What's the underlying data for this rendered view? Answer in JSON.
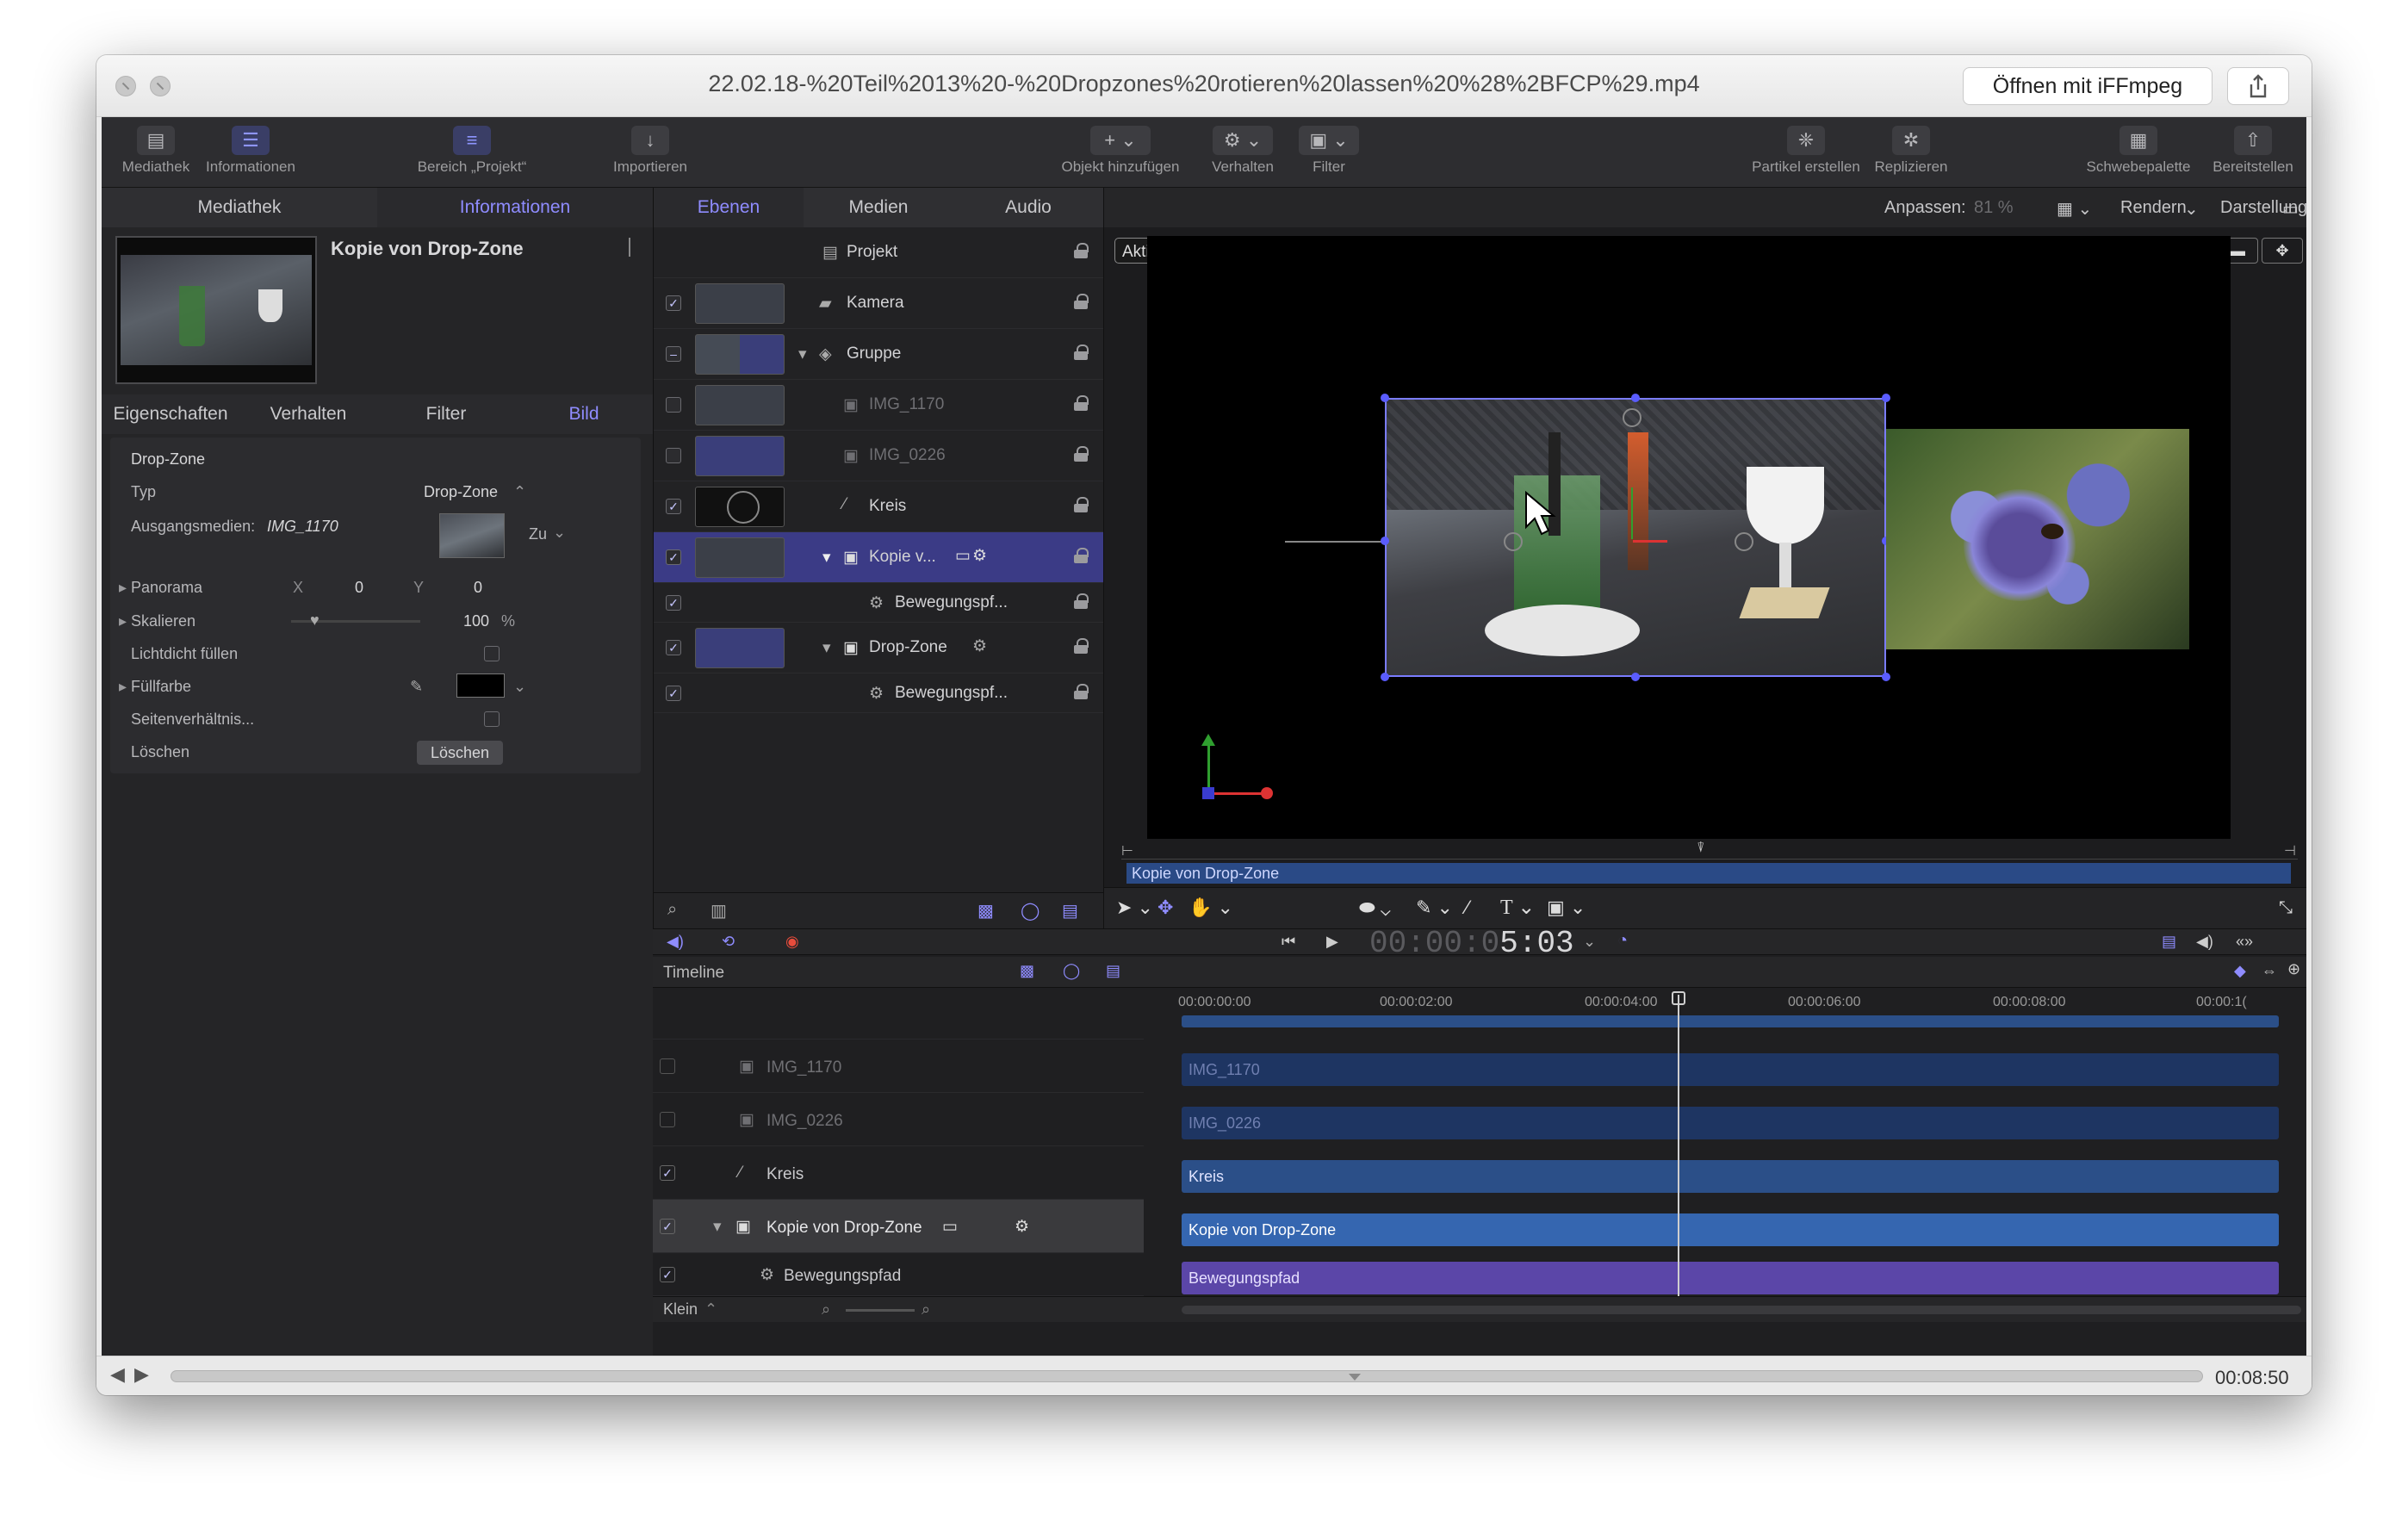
{
  "window": {
    "title": "22.02.18-%20Teil%2013%20-%20Dropzones%20rotieren%20lassen%20%28%2BFCP%29.mp4",
    "open_with_label": "Öffnen mit iFFmpeg",
    "share_icon": "share-icon"
  },
  "toolbar": {
    "library": "Mediathek",
    "inspector": "Informationen",
    "project_pane": "Bereich „Projekt“",
    "import": "Importieren",
    "add_object": "Objekt hinzufügen",
    "behaviors": "Verhalten",
    "filters": "Filter",
    "make_particles": "Partikel erstellen",
    "replicate": "Replizieren",
    "hud": "Schwebepalette",
    "share": "Bereitstellen"
  },
  "left_panel": {
    "tabs": [
      "Mediathek",
      "Informationen"
    ],
    "selected_tab": "Informationen",
    "preview_title": "Kopie von Drop-Zone",
    "sub_tabs": [
      "Eigenschaften",
      "Verhalten",
      "Filter",
      "Bild"
    ],
    "selected_sub_tab": "Bild",
    "section": "Drop-Zone",
    "props": {
      "type_label": "Typ",
      "type_value": "Drop-Zone",
      "source_label": "Ausgangsmedien:",
      "source_value": "IMG_1170",
      "to_label": "Zu",
      "pan_label": "Panorama",
      "pan_x_label": "X",
      "pan_x": "0",
      "pan_y_label": "Y",
      "pan_y": "0",
      "scale_label": "Skalieren",
      "scale_value": "100",
      "scale_unit": "%",
      "fill_opaque_label": "Lichtdicht füllen",
      "fill_color_label": "Füllfarbe",
      "aspect_label": "Seitenverhältnis...",
      "clear_label": "Löschen",
      "clear_button": "Löschen"
    }
  },
  "layers_panel": {
    "tabs": [
      "Ebenen",
      "Medien",
      "Audio"
    ],
    "selected_tab": "Ebenen",
    "rows": [
      {
        "name": "Projekt"
      },
      {
        "name": "Kamera"
      },
      {
        "name": "Gruppe"
      },
      {
        "name": "IMG_1170"
      },
      {
        "name": "IMG_0226"
      },
      {
        "name": "Kreis"
      },
      {
        "name": "Kopie v..."
      },
      {
        "name": "Bewegungspf..."
      },
      {
        "name": "Drop-Zone"
      },
      {
        "name": "Bewegungspf..."
      }
    ]
  },
  "canvas": {
    "zoom_label": "Anpassen:",
    "zoom_value": "81 %",
    "render_label": "Rendern",
    "view_label": "Darstellung",
    "camera_label": "Aktive Kamera",
    "mini_timeline_label": "Kopie von Drop-Zone"
  },
  "transport": {
    "timecode_dim": "00:00:0",
    "timecode_bright": "5:03"
  },
  "timeline": {
    "title": "Timeline",
    "ruler": [
      "00:00:00:00",
      "00:00:02:00",
      "00:00:04:00",
      "00:00:06:00",
      "00:00:08:00",
      "00:00:1("
    ],
    "rows": [
      {
        "name": "IMG_1170"
      },
      {
        "name": "IMG_0226"
      },
      {
        "name": "Kreis"
      },
      {
        "name": "Kopie von Drop-Zone"
      },
      {
        "name": "Bewegungspfad"
      }
    ],
    "tracks": [
      {
        "label": "IMG_1170"
      },
      {
        "label": "IMG_0226"
      },
      {
        "label": "Kreis"
      },
      {
        "label": "Kopie von Drop-Zone"
      },
      {
        "label": "Bewegungspfad"
      }
    ],
    "size_label": "Klein"
  },
  "player": {
    "duration": "00:08:50"
  },
  "colors": {
    "accent": "#8f8cff",
    "selection": "#3b3b86",
    "track_blue": "#2b4f88",
    "track_purple": "#5b46a8"
  }
}
